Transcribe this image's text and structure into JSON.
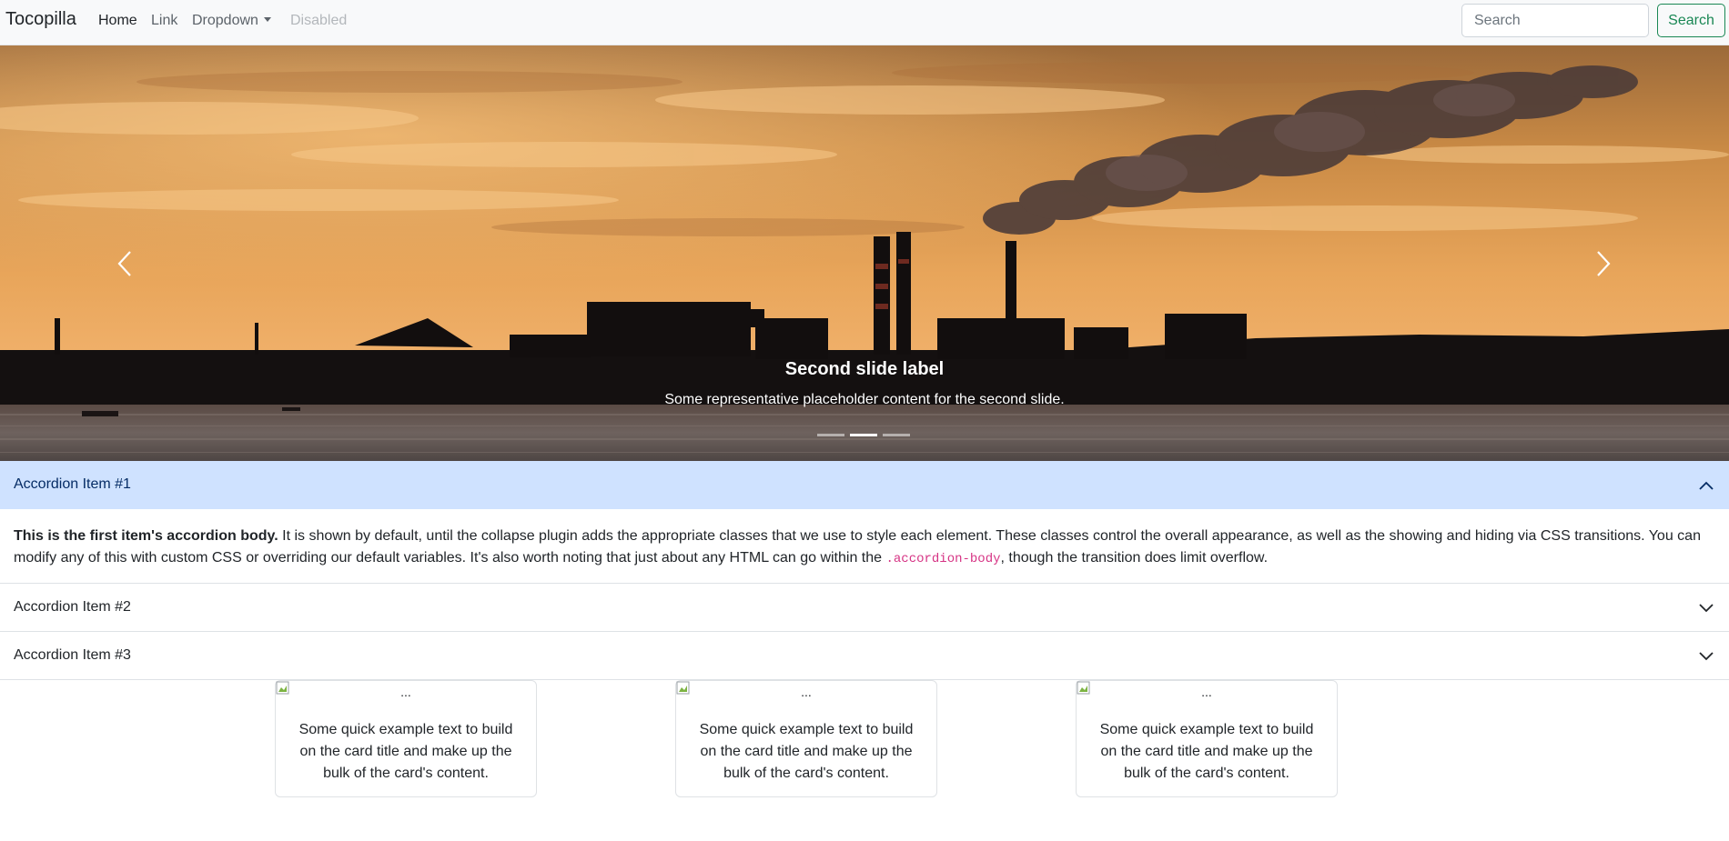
{
  "navbar": {
    "brand": "Tocopilla",
    "links": {
      "home": "Home",
      "link": "Link",
      "dropdown": "Dropdown",
      "disabled": "Disabled"
    },
    "search": {
      "placeholder": "Search",
      "button_label": "Search"
    }
  },
  "carousel": {
    "active_slide": 2,
    "slide_count": 3,
    "caption_title": "Second slide label",
    "caption_text": "Some representative placeholder content for the second slide."
  },
  "accordion": {
    "items": [
      {
        "label": "Accordion Item #1",
        "expanded": true,
        "body_strong": "This is the first item's accordion body.",
        "body_text_1": " It is shown by default, until the collapse plugin adds the appropriate classes that we use to style each element. These classes control the overall appearance, as well as the showing and hiding via CSS transitions. You can modify any of this with custom CSS or overriding our default variables. It's also worth noting that just about any HTML can go within the ",
        "body_code": ".accordion-body",
        "body_text_2": ", though the transition does limit overflow."
      },
      {
        "label": "Accordion Item #2",
        "expanded": false
      },
      {
        "label": "Accordion Item #3",
        "expanded": false
      }
    ]
  },
  "cards": [
    {
      "img_alt": "...",
      "text": "Some quick example text to build on the card title and make up the bulk of the card's content."
    },
    {
      "img_alt": "...",
      "text": "Some quick example text to build on the card title and make up the bulk of the card's content."
    },
    {
      "img_alt": "...",
      "text": "Some quick example text to build on the card title and make up the bulk of the card's content."
    }
  ],
  "colors": {
    "accent_success": "#198754",
    "accordion_active_bg": "#cfe2ff",
    "code_pink": "#d63384"
  },
  "icons": [
    "chevron-left-icon",
    "chevron-right-icon",
    "chevron-up-icon",
    "chevron-down-icon",
    "broken-image-icon",
    "caret-down-icon"
  ]
}
